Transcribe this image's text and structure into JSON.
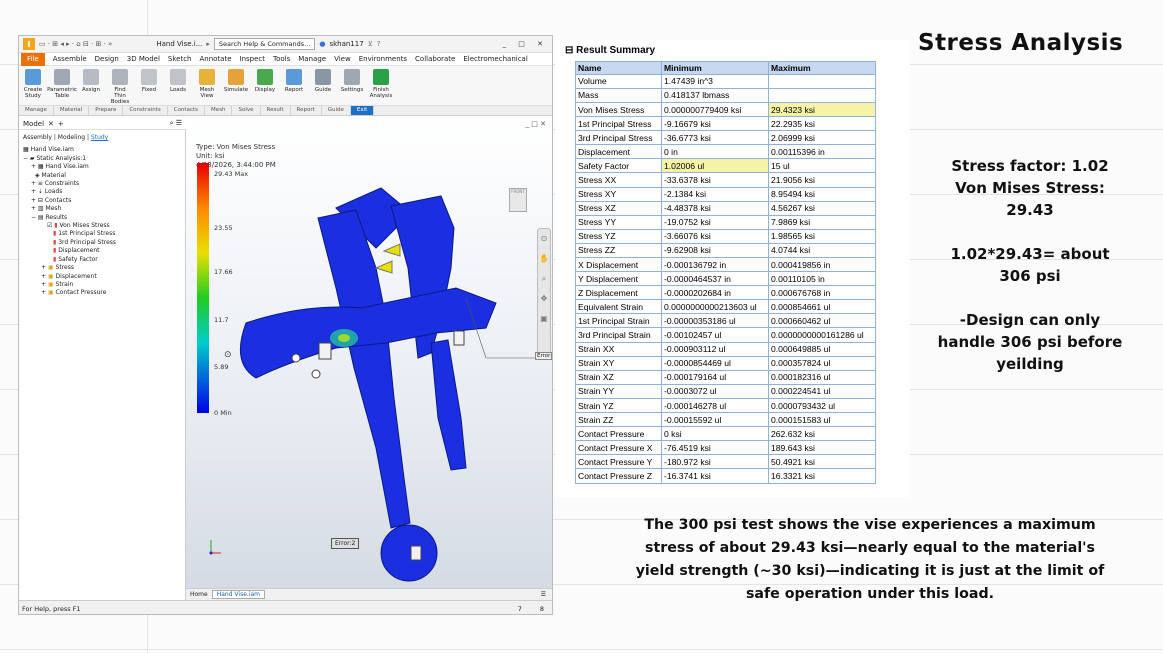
{
  "slide": {
    "title": "Stress Analysis",
    "notes": [
      "Stress factor: 1.02",
      "Von Mises Stress:",
      "29.43",
      "1.02*29.43= about",
      "306 psi",
      "-Design can only",
      "handle 306 psi before",
      "yeilding"
    ],
    "conclusion": [
      "The 300 psi test shows the vise experiences a maximum",
      "stress of about 29.43 ksi—nearly equal to the material's",
      "yield strength (~30 ksi)—indicating it is just at the limit of",
      "safe operation under this load."
    ]
  },
  "inventor": {
    "doc_title": "Hand Vise.i...",
    "search_placeholder": "Search Help & Commands...",
    "user": "skhan117",
    "menu": [
      "File",
      "Assemble",
      "Design",
      "3D Model",
      "Sketch",
      "Annotate",
      "Inspect",
      "Tools",
      "Manage",
      "View",
      "Environments",
      "Collaborate",
      "Electromechanical"
    ],
    "ribbon_buttons": [
      "Create Study",
      "Parametric Table",
      "Assign",
      "Find Thin Bodies",
      "Fixed",
      "Loads",
      "Mesh View",
      "Simulate",
      "Display",
      "Report",
      "Guide",
      "Settings",
      "Finish Analysis"
    ],
    "ribbon_panels": [
      "Manage",
      "Material",
      "Prepare",
      "Constraints",
      "Contacts",
      "Mesh",
      "Solve",
      "Result",
      "Report",
      "Guide",
      "Exit"
    ],
    "browser": {
      "tabs": [
        "Model",
        "+"
      ],
      "modes": [
        "Assembly",
        "Modeling",
        "Study"
      ],
      "tree": [
        "Hand Vise.iam",
        "Static Analysis:1",
        "Hand Vise.iam",
        "Material",
        "Constraints",
        "Loads",
        "Contacts",
        "Mesh",
        "Results",
        "Von Mises Stress",
        "1st Principal Stress",
        "3rd Principal Stress",
        "Displacement",
        "Safety Factor",
        "Stress",
        "Displacement",
        "Strain",
        "Contact Pressure"
      ]
    },
    "viewport": {
      "type": "Type: Von Mises Stress",
      "unit": "Unit: ksi",
      "date": "4/23/2026, 3:44:00 PM",
      "legend": [
        "29.43 Max",
        "23.55",
        "17.66",
        "11.7",
        "5.89",
        "0 Min"
      ],
      "error_box": "Error:2",
      "side_error": "Error",
      "viewcube": "FRONT"
    },
    "doc_tabs": [
      "Home",
      "Hand Vise.iam"
    ],
    "status": "For Help, press F1",
    "status_nums": [
      "7",
      "8"
    ],
    "colors": {
      "file_tab": "#e8710a",
      "accent": "#1f6fc5",
      "model": "#1b2fe0"
    }
  },
  "result_summary": {
    "title": "Result Summary",
    "headers": [
      "Name",
      "Minimum",
      "Maximum"
    ],
    "rows": [
      [
        "Volume",
        "1.47439 in^3",
        ""
      ],
      [
        "Mass",
        "0.418137 lbmass",
        ""
      ],
      [
        "Von Mises Stress",
        "0.000000779409 ksi",
        "29.4323 ksi"
      ],
      [
        "1st Principal Stress",
        "-9.16679 ksi",
        "22.2935 ksi"
      ],
      [
        "3rd Principal Stress",
        "-36.6773 ksi",
        "2.06999 ksi"
      ],
      [
        "Displacement",
        "0 in",
        "0.00115396 in"
      ],
      [
        "Safety Factor",
        "1.02006 ul",
        "15 ul"
      ],
      [
        "Stress XX",
        "-33.6378 ksi",
        "21.9056 ksi"
      ],
      [
        "Stress XY",
        "-2.1384 ksi",
        "8.95494 ksi"
      ],
      [
        "Stress XZ",
        "-4.48378 ksi",
        "4.56267 ksi"
      ],
      [
        "Stress YY",
        "-19.0752 ksi",
        "7.9869 ksi"
      ],
      [
        "Stress YZ",
        "-3.66076 ksi",
        "1.98565 ksi"
      ],
      [
        "Stress ZZ",
        "-9.62908 ksi",
        "4.0744 ksi"
      ],
      [
        "X Displacement",
        "-0.000136792 in",
        "0.000419856 in"
      ],
      [
        "Y Displacement",
        "-0.0000464537 in",
        "0.00110105 in"
      ],
      [
        "Z Displacement",
        "-0.0000202684 in",
        "0.000676768 in"
      ],
      [
        "Equivalent Strain",
        "0.0000000000213603 ul",
        "0.000854661 ul"
      ],
      [
        "1st Principal Strain",
        "-0.00000353186 ul",
        "0.000660462 ul"
      ],
      [
        "3rd Principal Strain",
        "-0.00102457 ul",
        "0.0000000000161286 ul"
      ],
      [
        "Strain XX",
        "-0.000903112 ul",
        "0.000649885 ul"
      ],
      [
        "Strain XY",
        "-0.0000854469 ul",
        "0.000357824 ul"
      ],
      [
        "Strain XZ",
        "-0.000179164 ul",
        "0.000182316 ul"
      ],
      [
        "Strain YY",
        "-0.0003072 ul",
        "0.000224541 ul"
      ],
      [
        "Strain YZ",
        "-0.000146278 ul",
        "0.0000793432 ul"
      ],
      [
        "Strain ZZ",
        "-0.00015592 ul",
        "0.000151583 ul"
      ],
      [
        "Contact Pressure",
        "0 ksi",
        "262.632 ksi"
      ],
      [
        "Contact Pressure X",
        "-76.4519 ksi",
        "189.643 ksi"
      ],
      [
        "Contact Pressure Y",
        "-180.972 ksi",
        "50.4921 ksi"
      ],
      [
        "Contact Pressure Z",
        "-16.3741 ksi",
        "16.3321 ksi"
      ]
    ],
    "highlight_color": "#f7f3a6",
    "header_color": "#c5d8ef"
  }
}
